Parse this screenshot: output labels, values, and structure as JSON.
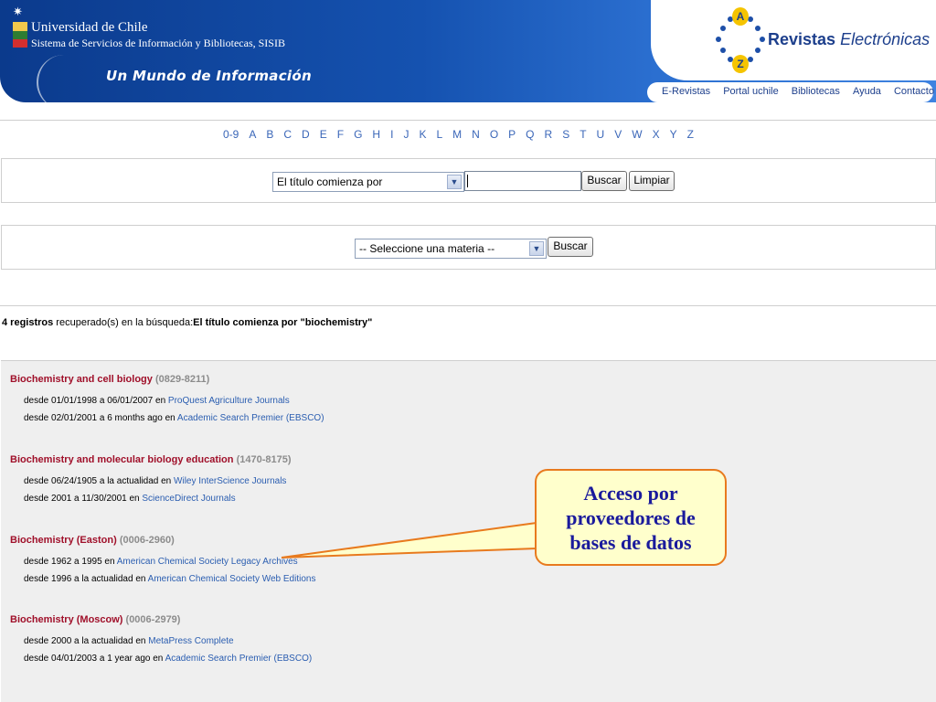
{
  "header": {
    "university": "Universidad de Chile",
    "system": "Sistema de Servicios de Información y Bibliotecas, SISIB",
    "tagline": "Un Mundo de Información",
    "brand_bold": "Revistas",
    "brand_italic": "Electrónicas",
    "az_top": "A",
    "az_bottom": "Z",
    "nav": [
      "E-Revistas",
      "Portal uchile",
      "Bibliotecas",
      "Ayuda",
      "Contacto"
    ],
    "colors": {
      "band": "#1552b0",
      "brand": "#1d3f8c"
    }
  },
  "alphabet": [
    "0-9",
    "A",
    "B",
    "C",
    "D",
    "E",
    "F",
    "G",
    "H",
    "I",
    "J",
    "K",
    "L",
    "M",
    "N",
    "O",
    "P",
    "Q",
    "R",
    "S",
    "T",
    "U",
    "V",
    "W",
    "X",
    "Y",
    "Z"
  ],
  "title_search": {
    "mode_selected": "El título comienza por",
    "query_value": "",
    "search_label": "Buscar",
    "clear_label": "Limpiar"
  },
  "subject_search": {
    "selected": "-- Seleccione una materia --",
    "search_label": "Buscar"
  },
  "results_summary": {
    "count": "4 registros",
    "middle": " recuperado(s) en la búsqueda:",
    "query": "El título comienza por \"biochemistry\""
  },
  "journals": [
    {
      "title": "Biochemistry and cell biology",
      "issn": "(0829-8211)",
      "holdings": [
        {
          "range": "desde 01/01/1998 a 06/01/2007 en ",
          "provider": "ProQuest Agriculture Journals"
        },
        {
          "range": "desde 02/01/2001 a 6 months ago en ",
          "provider": "Academic Search Premier (EBSCO)"
        }
      ]
    },
    {
      "title": "Biochemistry and molecular biology education",
      "issn": "(1470-8175)",
      "holdings": [
        {
          "range": "desde 06/24/1905 a la actualidad en ",
          "provider": "Wiley InterScience Journals"
        },
        {
          "range": "desde 2001 a 11/30/2001 en ",
          "provider": "ScienceDirect Journals"
        }
      ]
    },
    {
      "title": "Biochemistry (Easton)",
      "issn": "(0006-2960)",
      "holdings": [
        {
          "range": "desde 1962 a 1995 en ",
          "provider": "American Chemical Society Legacy Archives"
        },
        {
          "range": "desde 1996 a la actualidad en ",
          "provider": "American Chemical Society Web Editions"
        }
      ]
    },
    {
      "title": "Biochemistry (Moscow)",
      "issn": "(0006-2979)",
      "holdings": [
        {
          "range": "desde 2000 a la actualidad en ",
          "provider": "MetaPress Complete"
        },
        {
          "range": "desde 04/01/2003 a 1 year ago en ",
          "provider": "Academic Search Premier (EBSCO)"
        }
      ]
    }
  ],
  "callout": {
    "text": "Acceso por proveedores de bases de datos",
    "colors": {
      "fill": "#ffffcc",
      "border": "#e87a1e",
      "text": "#1a1a9c"
    }
  }
}
